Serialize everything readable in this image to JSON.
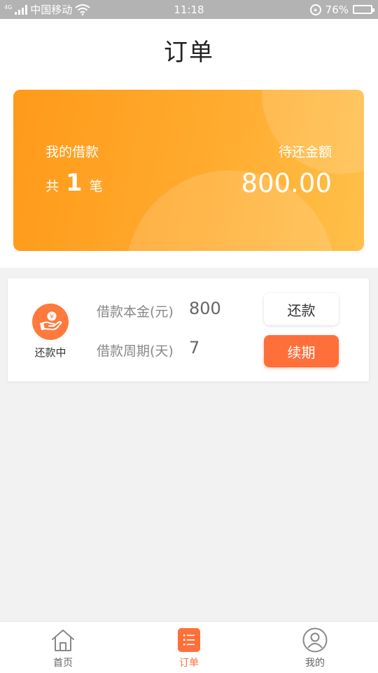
{
  "status_bar": {
    "network": "4G",
    "carrier": "中国移动",
    "time": "11:18",
    "battery_percent": "76%",
    "battery_level": 0.76
  },
  "header": {
    "title": "订单"
  },
  "summary_card": {
    "my_loan_label": "我的借款",
    "count_prefix": "共",
    "count": "1",
    "count_suffix": "笔",
    "due_label": "待还金额",
    "due_amount": "800.00"
  },
  "order": {
    "status_label": "还款中",
    "principal_label": "借款本金(元)",
    "principal_value": "800",
    "period_label": "借款周期(天)",
    "period_value": "7",
    "repay_button": "还款",
    "renew_button": "续期"
  },
  "nav": {
    "items": [
      {
        "label": "首页",
        "icon": "home-icon"
      },
      {
        "label": "订单",
        "icon": "order-list-icon"
      },
      {
        "label": "我的",
        "icon": "user-icon"
      }
    ],
    "active_index": 1
  },
  "colors": {
    "accent": "#ff6f3a",
    "card_gradient_start": "#ff9a1a",
    "card_gradient_end": "#ffc04a",
    "status_bar": "#b3b3b3",
    "background": "#f2f2f2"
  }
}
